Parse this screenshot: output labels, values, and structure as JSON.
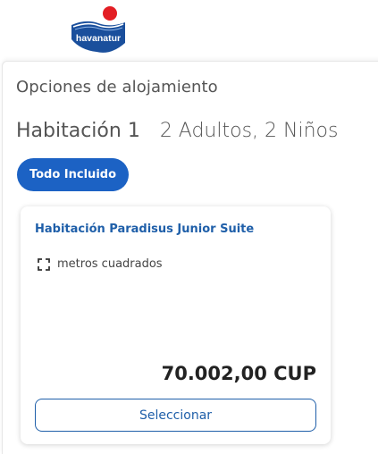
{
  "header": {
    "logo_text": "havanatur"
  },
  "section": {
    "title": "Opciones de alojamiento"
  },
  "room": {
    "name": "Habitación 1",
    "occupancy": "2 Adultos, 2 Niños"
  },
  "plan": {
    "label": "Todo Incluido"
  },
  "card": {
    "title": "Habitación Paradisus Junior Suite",
    "area_label": "metros cuadrados",
    "area_icon": "expand-corners-icon",
    "price": "70.002,00 CUP",
    "select_label": "Seleccionar"
  },
  "colors": {
    "accent": "#1c62c4",
    "link": "#1f5fa9",
    "logo_red": "#e31e24",
    "logo_blue": "#1a4f9c"
  }
}
